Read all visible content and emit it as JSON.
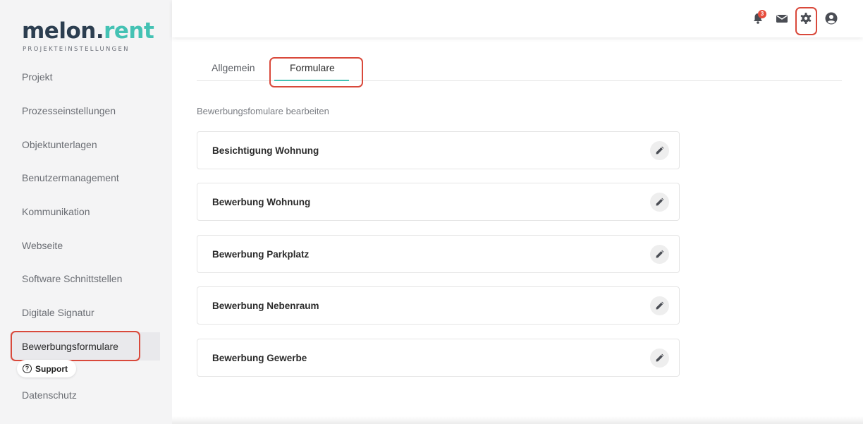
{
  "brand": {
    "name_part1": "melon.",
    "name_part2": "rent",
    "subtitle": "PROJEKTEINSTELLUNGEN"
  },
  "sidebar": {
    "items": [
      {
        "label": "Projekt",
        "icon": ""
      },
      {
        "label": "Prozesseinstellungen"
      },
      {
        "label": "Objektunterlagen"
      },
      {
        "label": "Benutzermanagement"
      },
      {
        "label": "Kommunikation"
      },
      {
        "label": "Webseite"
      },
      {
        "label": "Software Schnittstellen"
      },
      {
        "label": "Digitale Signatur"
      },
      {
        "label": "Bewerbungsformulare"
      },
      {
        "label": "Datenschutz"
      }
    ],
    "active_index": 8
  },
  "support": {
    "label": "Support",
    "icon": "question-circle-icon"
  },
  "topbar": {
    "notification_count": "3",
    "icons": [
      "bell-icon",
      "mail-icon",
      "gear-icon",
      "user-circle-icon"
    ]
  },
  "tabs": [
    {
      "label": "Allgemein",
      "active": false
    },
    {
      "label": "Formulare",
      "active": true
    }
  ],
  "section_title": "Bewerbungsfomulare bearbeiten",
  "forms": [
    {
      "label": "Besichtigung Wohnung"
    },
    {
      "label": "Bewerbung Wohnung"
    },
    {
      "label": "Bewerbung Parkplatz"
    },
    {
      "label": "Bewerbung Nebenraum"
    },
    {
      "label": "Bewerbung Gewerbe"
    }
  ],
  "colors": {
    "accent": "#44c2b4",
    "highlight": "#d9493b",
    "badge": "#e74c3c",
    "logo_dark": "#2c3e50"
  }
}
